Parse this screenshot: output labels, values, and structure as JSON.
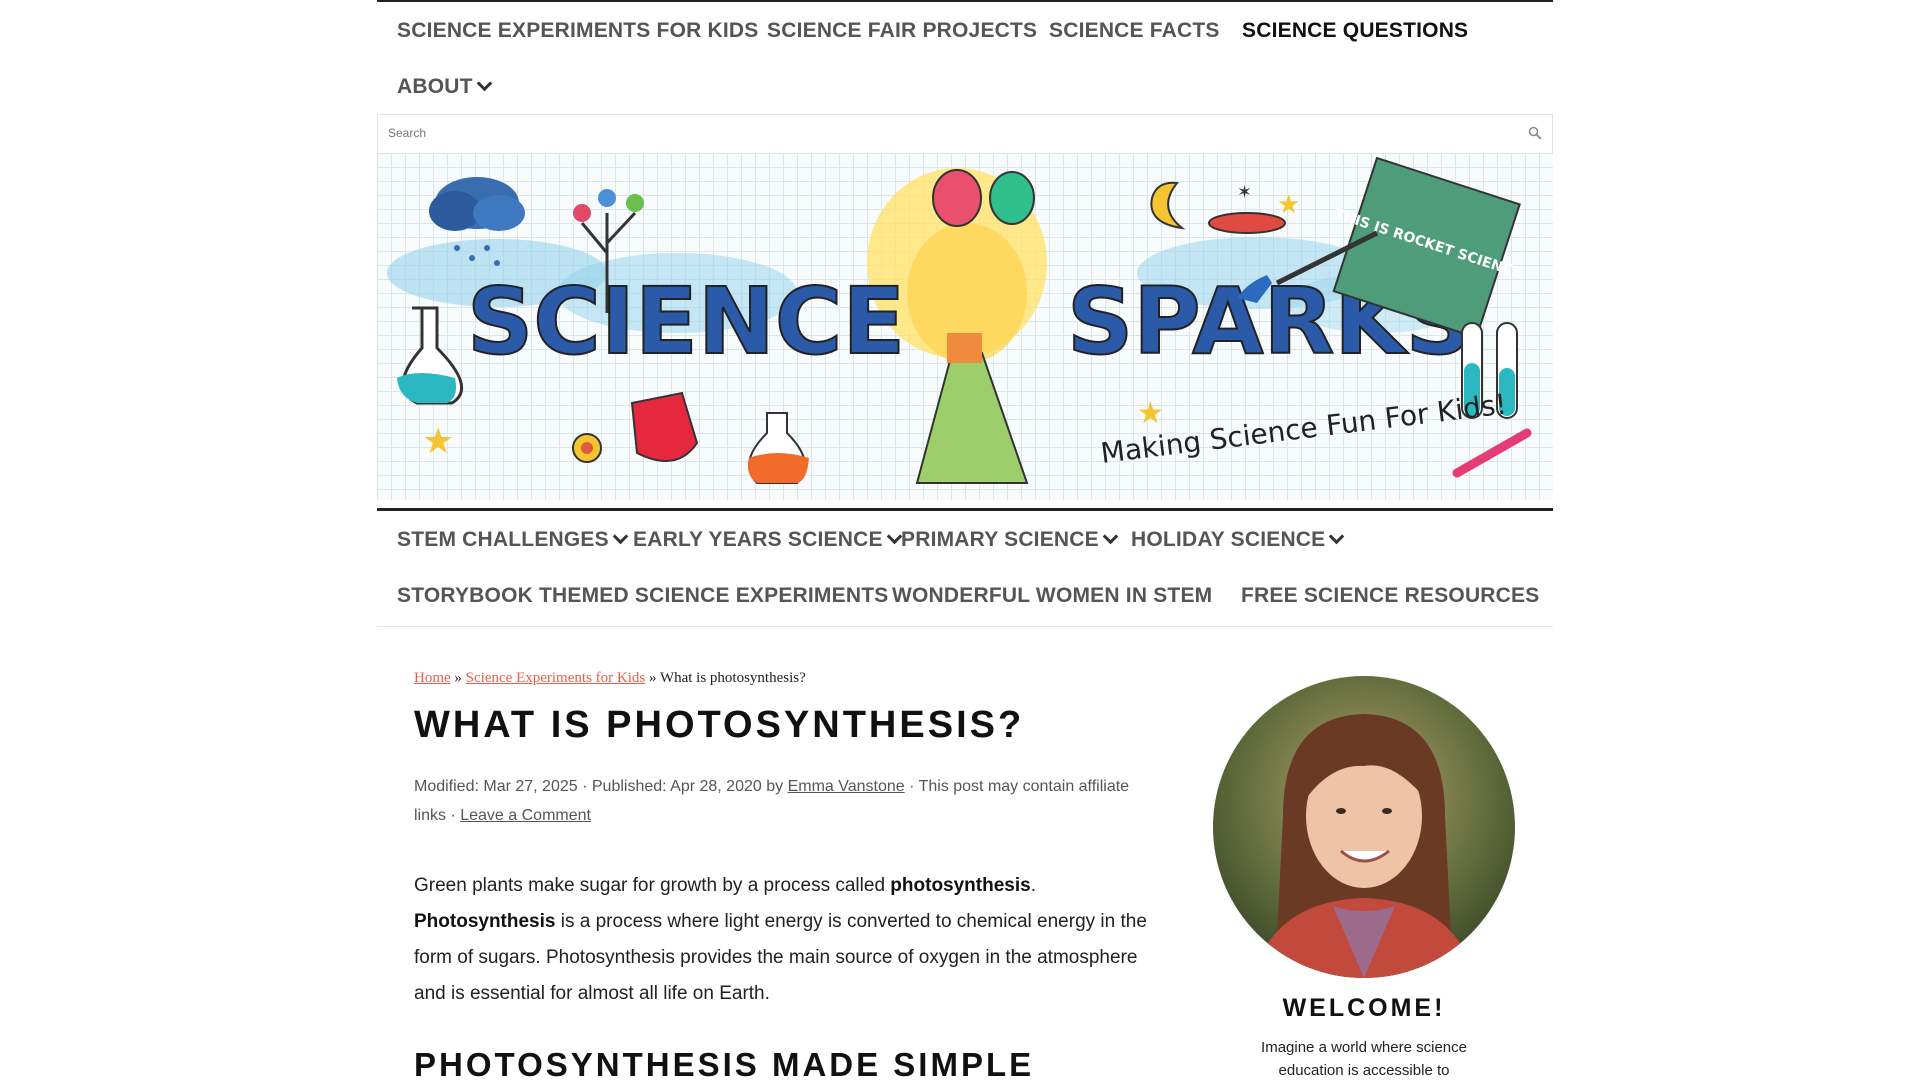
{
  "top_nav": {
    "items": [
      {
        "label": "SCIENCE EXPERIMENTS FOR KIDS"
      },
      {
        "label": "SCIENCE FAIR PROJECTS"
      },
      {
        "label": "SCIENCE FACTS"
      },
      {
        "label": "SCIENCE QUESTIONS"
      },
      {
        "label": "ABOUT"
      }
    ]
  },
  "search": {
    "placeholder": "Search"
  },
  "banner": {
    "title_left": "SCIENCE",
    "title_right": "SPARKS",
    "tagline": "Making Science Fun For Kids!",
    "book_title": "THIS IS ROCKET SCIENCE"
  },
  "sub_nav": {
    "items": [
      {
        "label": "STEM CHALLENGES"
      },
      {
        "label": "EARLY YEARS SCIENCE"
      },
      {
        "label": "PRIMARY SCIENCE"
      },
      {
        "label": "HOLIDAY SCIENCE"
      },
      {
        "label": "STORYBOOK THEMED SCIENCE EXPERIMENTS"
      },
      {
        "label": "WONDERFUL WOMEN IN STEM"
      },
      {
        "label": "FREE SCIENCE RESOURCES"
      }
    ]
  },
  "breadcrumb": {
    "home": "Home",
    "sep1": " » ",
    "category": "Science Experiments for Kids",
    "sep2": " » ",
    "current": "What is photosynthesis?"
  },
  "article": {
    "title": "WHAT IS PHOTOSYNTHESIS?",
    "meta": {
      "modified": "Modified: Mar 27, 2025 · Published: Apr 28, 2020 by ",
      "author": "Emma Vanstone",
      "affiliate": " · This post may contain affiliate links · ",
      "comment_link": "Leave a Comment"
    },
    "para": {
      "t1": "Green plants make sugar for growth by a process called ",
      "b1": "photosynthesis",
      "t2": ". ",
      "b2": "Photosynthesis",
      "t3": " is a process where light energy is converted to chemical energy in the form of sugars. Photosynthesis provides the main source of oxygen in the atmosphere and is essential for almost all life on Earth."
    },
    "heading2": "PHOTOSYNTHESIS MADE SIMPLE"
  },
  "sidebar": {
    "welcome_title": "WELCOME!",
    "welcome_text": "Imagine a world where science education is accessible to"
  }
}
